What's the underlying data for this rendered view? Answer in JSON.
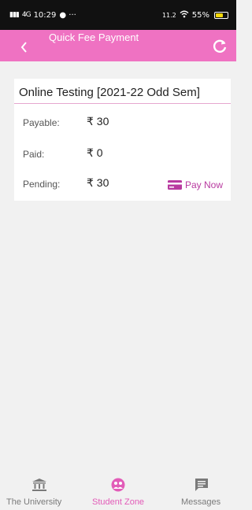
{
  "status_bar": {
    "signal_1": "░",
    "signal_2": "4G",
    "time": "10:29",
    "extra": "● ···",
    "net_speed": "11.2",
    "battery": "55%"
  },
  "header": {
    "back_icon": "chevron-left-icon",
    "title": "Quick Fee Payment",
    "refresh_icon": "refresh-icon"
  },
  "fee_card": {
    "title": "Online Testing [2021-22 Odd Sem]",
    "rows": [
      {
        "label": "Payable:",
        "amount": "₹ 30"
      },
      {
        "label": "Paid:",
        "amount": "₹ 0"
      },
      {
        "label": "Pending:",
        "amount": "₹ 30"
      }
    ],
    "pay_now_label": "Pay Now"
  },
  "bottom_nav": {
    "items": [
      {
        "label": "The University",
        "icon": "university-icon",
        "active": false
      },
      {
        "label": "Student Zone",
        "icon": "student-zone-icon",
        "active": true
      },
      {
        "label": "Messages",
        "icon": "messages-icon",
        "active": false
      }
    ]
  },
  "colors": {
    "header_bg": "#ef72c2",
    "accent": "#b83aa0",
    "nav_active": "#e25cb8",
    "nav_inactive": "#7a7a7a"
  }
}
